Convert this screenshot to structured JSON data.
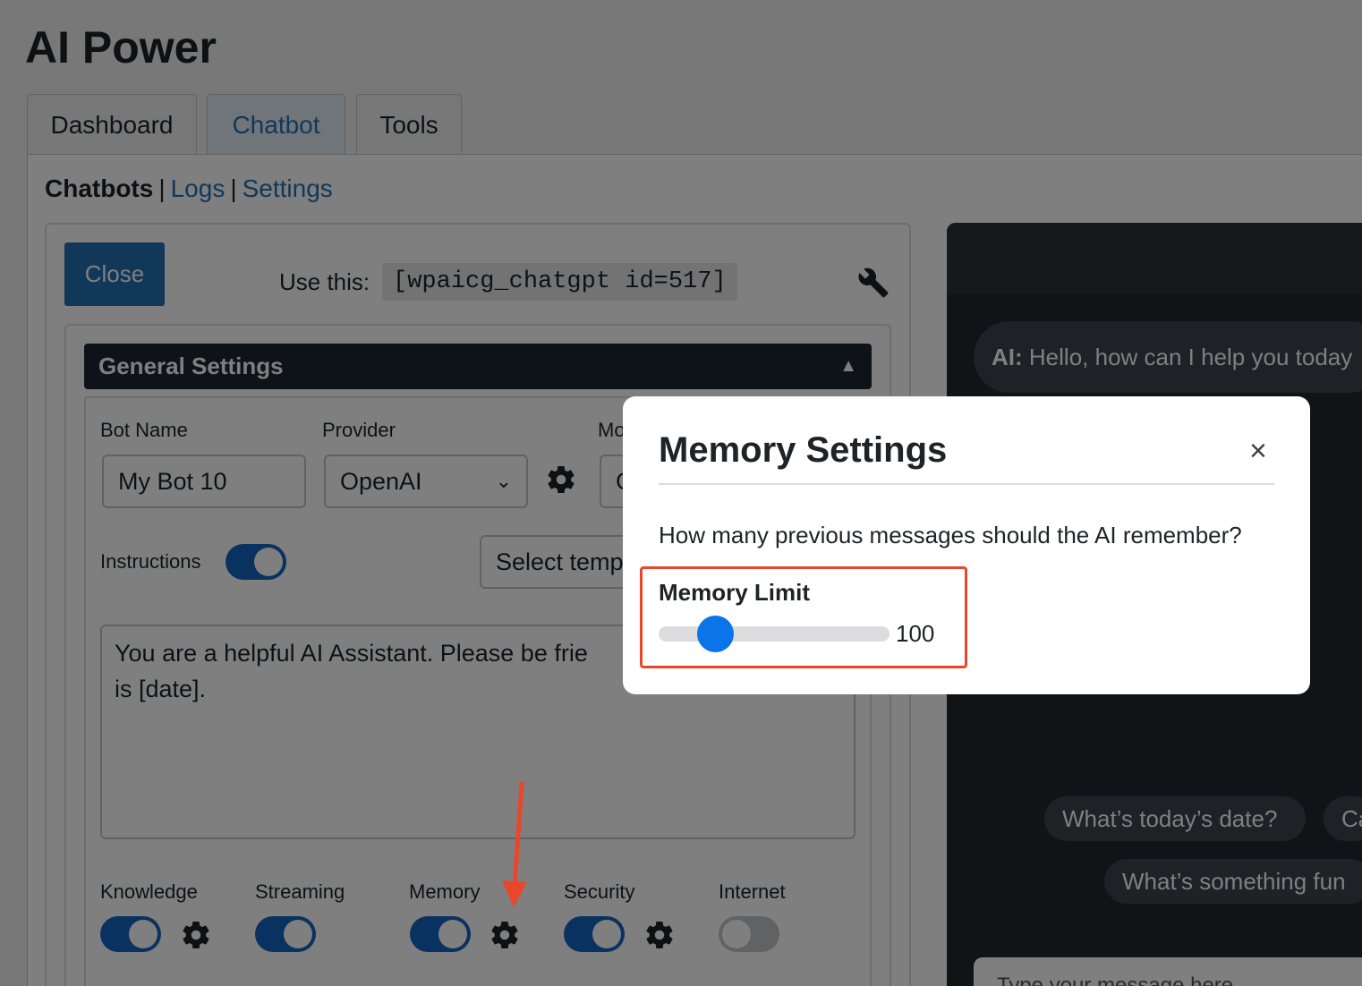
{
  "app": {
    "title": "AI Power"
  },
  "tabs": [
    {
      "label": "Dashboard",
      "active": false
    },
    {
      "label": "Chatbot",
      "active": true
    },
    {
      "label": "Tools",
      "active": false
    }
  ],
  "subnav": {
    "current": "Chatbots",
    "links": [
      "Logs",
      "Settings"
    ],
    "separator": "|"
  },
  "toolbar": {
    "close_label": "Close",
    "use_this_label": "Use this:",
    "shortcode": "[wpaicg_chatgpt id=517]"
  },
  "general_settings": {
    "header": "General Settings",
    "collapse_glyph": "▲",
    "bot_name": {
      "label": "Bot Name",
      "value": "My Bot 10"
    },
    "provider": {
      "label": "Provider",
      "value": "OpenAI"
    },
    "model": {
      "label": "Mo",
      "value": "G"
    },
    "instructions": {
      "label": "Instructions",
      "enabled": true
    },
    "template_select": {
      "value": "Select temp"
    },
    "instructions_text": "You are a helpful AI Assistant. Please be frie\nis [date].",
    "features": [
      {
        "label": "Knowledge",
        "enabled": true,
        "has_gear": true
      },
      {
        "label": "Streaming",
        "enabled": true,
        "has_gear": false
      },
      {
        "label": "Memory",
        "enabled": true,
        "has_gear": true
      },
      {
        "label": "Security",
        "enabled": true,
        "has_gear": true
      },
      {
        "label": "Internet",
        "enabled": false,
        "has_gear": false
      }
    ]
  },
  "chat_preview": {
    "ai_prefix": "AI:",
    "ai_message": "Hello, how can I help you today",
    "chips": [
      "What’s today’s date?",
      "Ca",
      "What’s something fun"
    ],
    "input_placeholder": "Type your message here"
  },
  "modal": {
    "title": "Memory Settings",
    "close_glyph": "×",
    "question": "How many previous messages should the AI remember?",
    "memory_limit": {
      "label": "Memory Limit",
      "value": "100",
      "fraction": 0.2
    }
  },
  "colors": {
    "accent": "#2271b1",
    "toggle_on": "#1565c0",
    "slider_thumb": "#0a74e8",
    "highlight": "#e8472b",
    "annotation_arrow": "#e8472b"
  }
}
